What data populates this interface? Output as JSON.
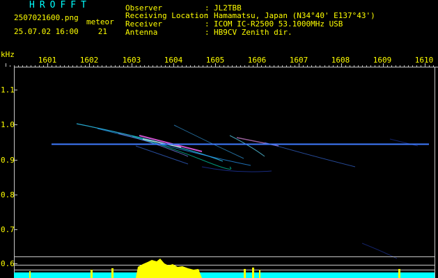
{
  "header": {
    "title": "HROFFT",
    "file_name": "2507021600.png",
    "datetime": "25.07.02 16:00",
    "meteor_label": "meteor",
    "meteor_count": "21"
  },
  "info": [
    {
      "key": "Observer",
      "sep": ":",
      "value": "JL2TBB"
    },
    {
      "key": "Receiving Location",
      "sep": ":",
      "value": "Hamamatsu, Japan (N34°40' E137°43')"
    },
    {
      "key": "Receiver",
      "sep": ":",
      "value": "ICOM IC-R2500 53.1000MHz USB"
    },
    {
      "key": "Antenna",
      "sep": ":",
      "value": "HB9CV Zenith dir."
    }
  ],
  "axis": {
    "y_unit": "kHz",
    "x_ticks": [
      "1601",
      "1602",
      "1603",
      "1604",
      "1605",
      "1606",
      "1607",
      "1608",
      "1609",
      "1610"
    ],
    "y_ticks": [
      "1.1",
      "1.0",
      "0.9",
      "0.8",
      "0.7",
      "0.6"
    ]
  },
  "colors": {
    "text": "#ffff00",
    "title": "#00ffff",
    "grid": "#c8c8c8",
    "carrier": "#3f7bff",
    "level_high": "#ffff00",
    "level_low": "#00ffff"
  }
}
